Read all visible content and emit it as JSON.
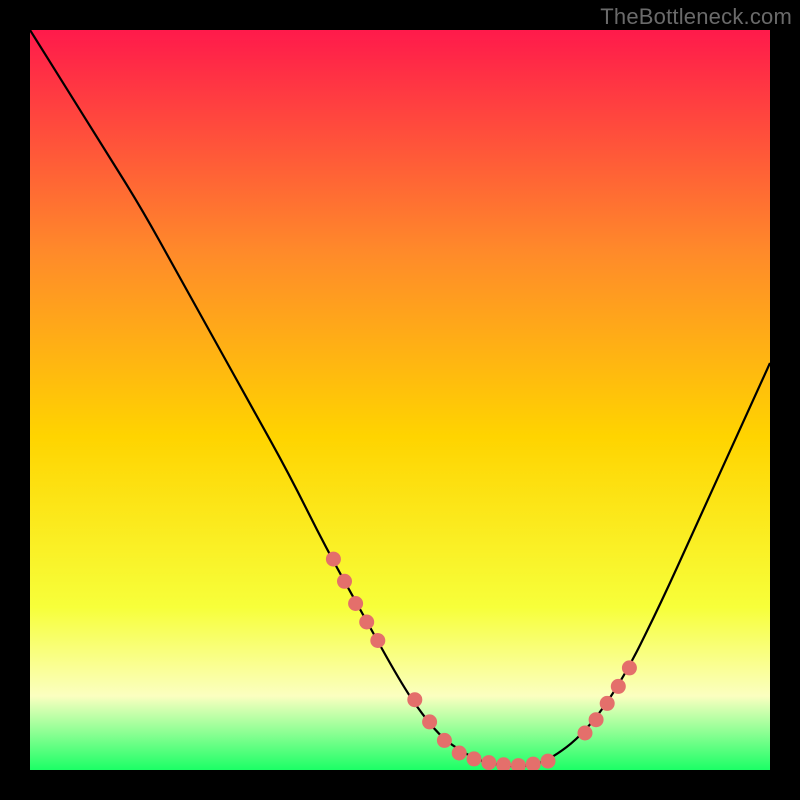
{
  "watermark": "TheBottleneck.com",
  "colors": {
    "background_black": "#000000",
    "gradient_top": "#ff1a4b",
    "gradient_mid_upper": "#ff8a2a",
    "gradient_mid": "#ffd400",
    "gradient_mid_lower": "#f7ff3a",
    "gradient_pale": "#fbffc0",
    "gradient_bottom": "#1bff66",
    "curve": "#000000",
    "marker_fill": "#e46f6b",
    "marker_stroke": "#c85a56"
  },
  "chart_data": {
    "type": "line",
    "title": "",
    "xlabel": "",
    "ylabel": "",
    "xlim": [
      0,
      100
    ],
    "ylim": [
      0,
      100
    ],
    "grid": false,
    "legend": false,
    "series": [
      {
        "name": "bottleneck-curve",
        "x": [
          0,
          5,
          10,
          15,
          20,
          25,
          30,
          35,
          40,
          45,
          50,
          53,
          56,
          60,
          63,
          66.5,
          70,
          75,
          80,
          85,
          90,
          95,
          100
        ],
        "y": [
          100,
          92,
          84,
          76,
          67,
          58,
          49,
          40,
          30,
          21,
          12,
          7.5,
          4,
          1.5,
          0.7,
          0.4,
          1.2,
          5,
          12,
          22,
          33,
          44,
          55
        ]
      }
    ],
    "markers": {
      "name": "highlighted-points",
      "x": [
        41,
        42.5,
        44,
        45.5,
        47,
        52,
        54,
        56,
        58,
        60,
        62,
        64,
        66,
        68,
        70,
        75,
        76.5,
        78,
        79.5,
        81
      ],
      "y": [
        28.5,
        25.5,
        22.5,
        20.0,
        17.5,
        9.5,
        6.5,
        4.0,
        2.3,
        1.5,
        1.0,
        0.7,
        0.6,
        0.8,
        1.2,
        5.0,
        6.8,
        9.0,
        11.3,
        13.8
      ]
    }
  }
}
